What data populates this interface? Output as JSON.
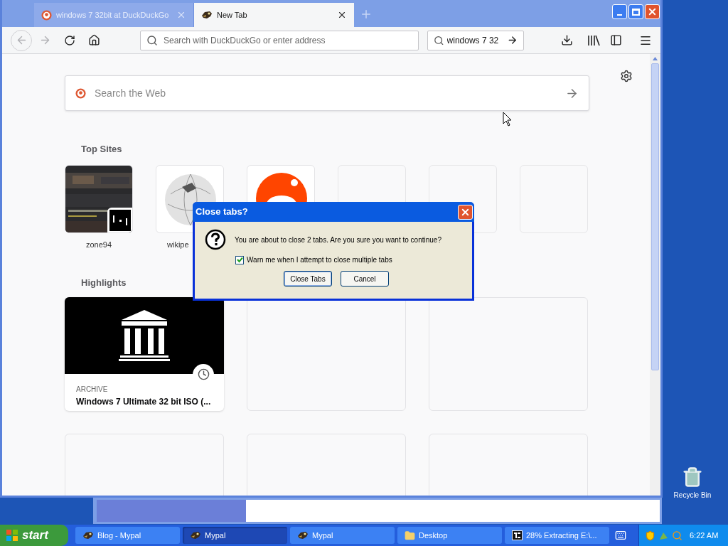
{
  "browser": {
    "tabs": [
      {
        "title": "windows 7 32bit at DuckDuckGo",
        "kind": "duck",
        "selected": false
      },
      {
        "title": "New Tab",
        "kind": "mypal",
        "selected": true
      }
    ],
    "address_bar": {
      "placeholder": "Search with DuckDuckGo or enter address"
    },
    "search_bar": {
      "value": "windows 7 32"
    },
    "newtab": {
      "search": {
        "placeholder": "Search the Web"
      },
      "top_sites": {
        "heading": "Top Sites",
        "tiles": [
          {
            "kind": "screenshot",
            "label": "zone94"
          },
          {
            "kind": "globe",
            "label": "wikipe"
          },
          {
            "kind": "alien"
          },
          {
            "kind": "empty"
          },
          {
            "kind": "empty"
          },
          {
            "kind": "empty"
          }
        ]
      },
      "highlights": {
        "heading": "Highlights",
        "cards": [
          {
            "kind": "archive",
            "source": "ARCHIVE",
            "title": "Windows 7 Ultimate 32 bit ISO (..."
          },
          {
            "kind": "empty"
          },
          {
            "kind": "empty"
          },
          {
            "kind": "empty"
          },
          {
            "kind": "empty"
          },
          {
            "kind": "empty"
          }
        ]
      }
    }
  },
  "dialog": {
    "title": "Close tabs?",
    "message": "You are about to close 2 tabs. Are you sure you want to continue?",
    "checkbox": {
      "label": "Warn me when I attempt to close multiple tabs",
      "checked": true
    },
    "buttons": [
      {
        "label": "Close Tabs",
        "selected": true
      },
      {
        "label": "Cancel",
        "selected": false
      }
    ]
  },
  "progress_window": {
    "level": 0.265
  },
  "desktop_icons": [
    {
      "label": "Recycle Bin"
    }
  ],
  "taskbar": {
    "start": "start",
    "items": [
      {
        "label": "Blog - Mypal",
        "kind": "mypal",
        "selected": false
      },
      {
        "label": "Mypal",
        "kind": "mypal",
        "selected": true
      },
      {
        "label": "Mypal",
        "kind": "mypal",
        "selected": false
      },
      {
        "label": "Desktop",
        "kind": "folder",
        "selected": false
      },
      {
        "label": "28% Extracting E:\\...",
        "kind": "archive",
        "selected": false
      }
    ],
    "clock": "6:22 AM"
  }
}
